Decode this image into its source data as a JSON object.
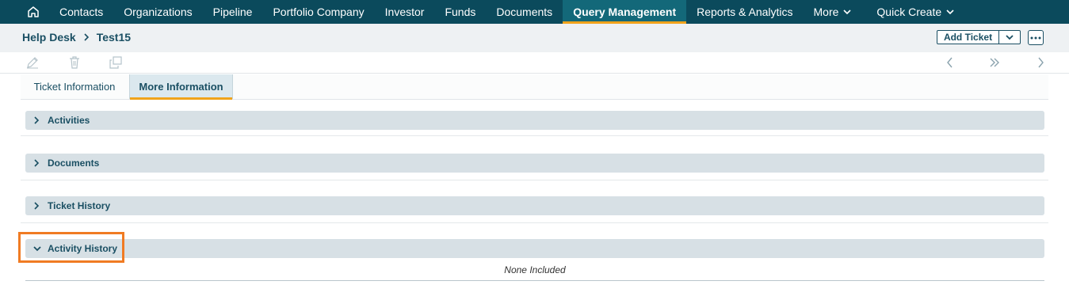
{
  "nav": {
    "home_icon": "home-icon",
    "items": [
      "Contacts",
      "Organizations",
      "Pipeline",
      "Portfolio Company",
      "Investor",
      "Funds",
      "Documents",
      "Query Management",
      "Reports & Analytics"
    ],
    "active": "Query Management",
    "more": "More",
    "quick_create": "Quick Create"
  },
  "header": {
    "breadcrumb_root": "Help Desk",
    "breadcrumb_current": "Test15",
    "add_ticket": "Add Ticket"
  },
  "tabs": {
    "ticket_information": "Ticket Information",
    "more_information": "More Information"
  },
  "sections": {
    "activities": "Activities",
    "documents": "Documents",
    "ticket_history": "Ticket History",
    "activity_history": "Activity History"
  },
  "activity_history": {
    "empty_text": "None Included"
  },
  "colors": {
    "nav_bg": "#0b4a5c",
    "accent": "#f0a31b",
    "highlight": "#f07b23",
    "text_primary": "#1a4f63"
  }
}
